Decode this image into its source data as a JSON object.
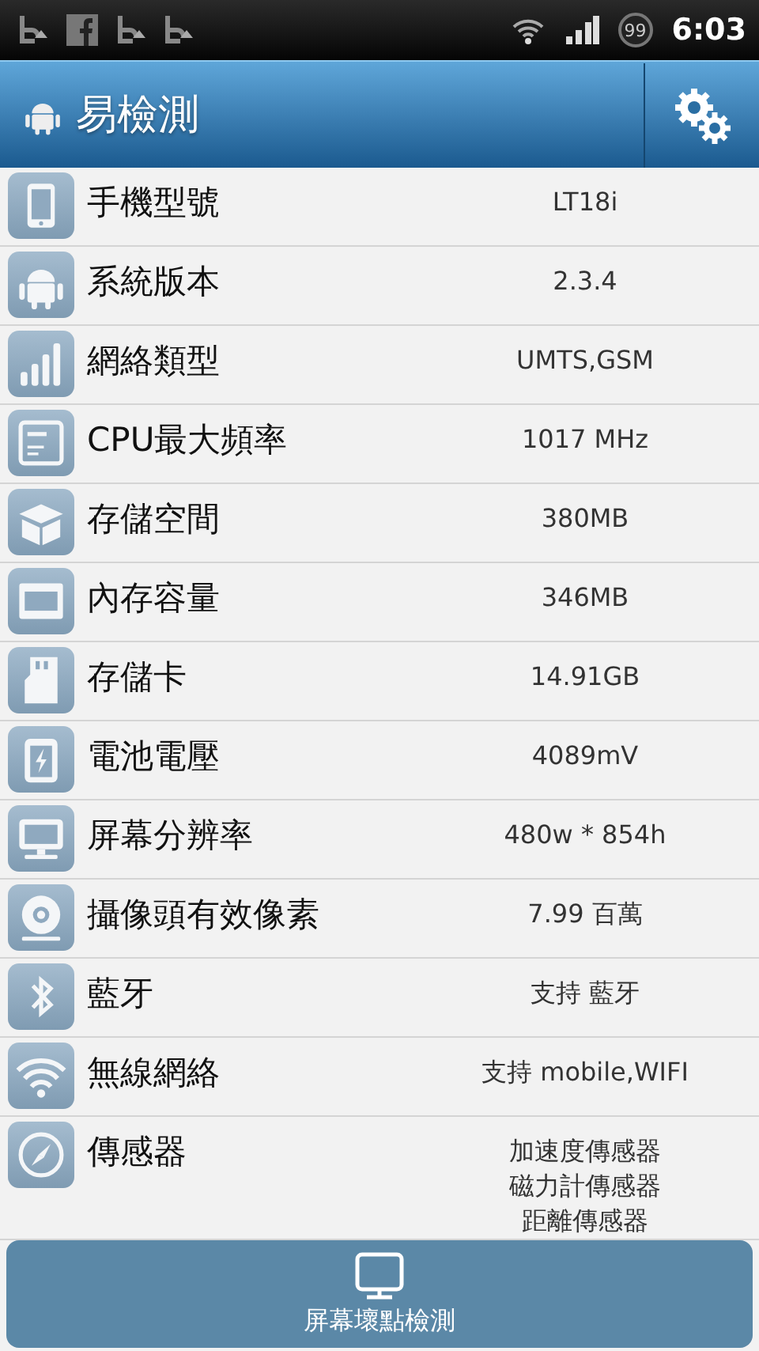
{
  "status_bar": {
    "battery": "99",
    "time": "6:03"
  },
  "title_bar": {
    "title": "易檢測"
  },
  "rows": [
    {
      "label": "手機型號",
      "values": [
        "LT18i"
      ]
    },
    {
      "label": "系統版本",
      "values": [
        "2.3.4"
      ]
    },
    {
      "label": "網絡類型",
      "values": [
        "UMTS,GSM"
      ]
    },
    {
      "label": "CPU最大頻率",
      "values": [
        "1017 MHz"
      ]
    },
    {
      "label": "存儲空間",
      "values": [
        "380MB"
      ]
    },
    {
      "label": "內存容量",
      "values": [
        "346MB"
      ]
    },
    {
      "label": "存儲卡",
      "values": [
        "14.91GB"
      ]
    },
    {
      "label": "電池電壓",
      "values": [
        "4089mV"
      ]
    },
    {
      "label": "屏幕分辨率",
      "values": [
        "480w * 854h"
      ]
    },
    {
      "label": "攝像頭有效像素",
      "values": [
        "7.99 百萬"
      ]
    },
    {
      "label": "藍牙",
      "values": [
        "支持 藍牙"
      ]
    },
    {
      "label": "無線網絡",
      "values": [
        "支持 mobile,WIFI"
      ]
    },
    {
      "label": "傳感器",
      "values": [
        "加速度傳感器",
        "磁力計傳感器",
        "距離傳感器"
      ]
    }
  ],
  "bottom_button": {
    "label": "屏幕壞點檢測"
  }
}
